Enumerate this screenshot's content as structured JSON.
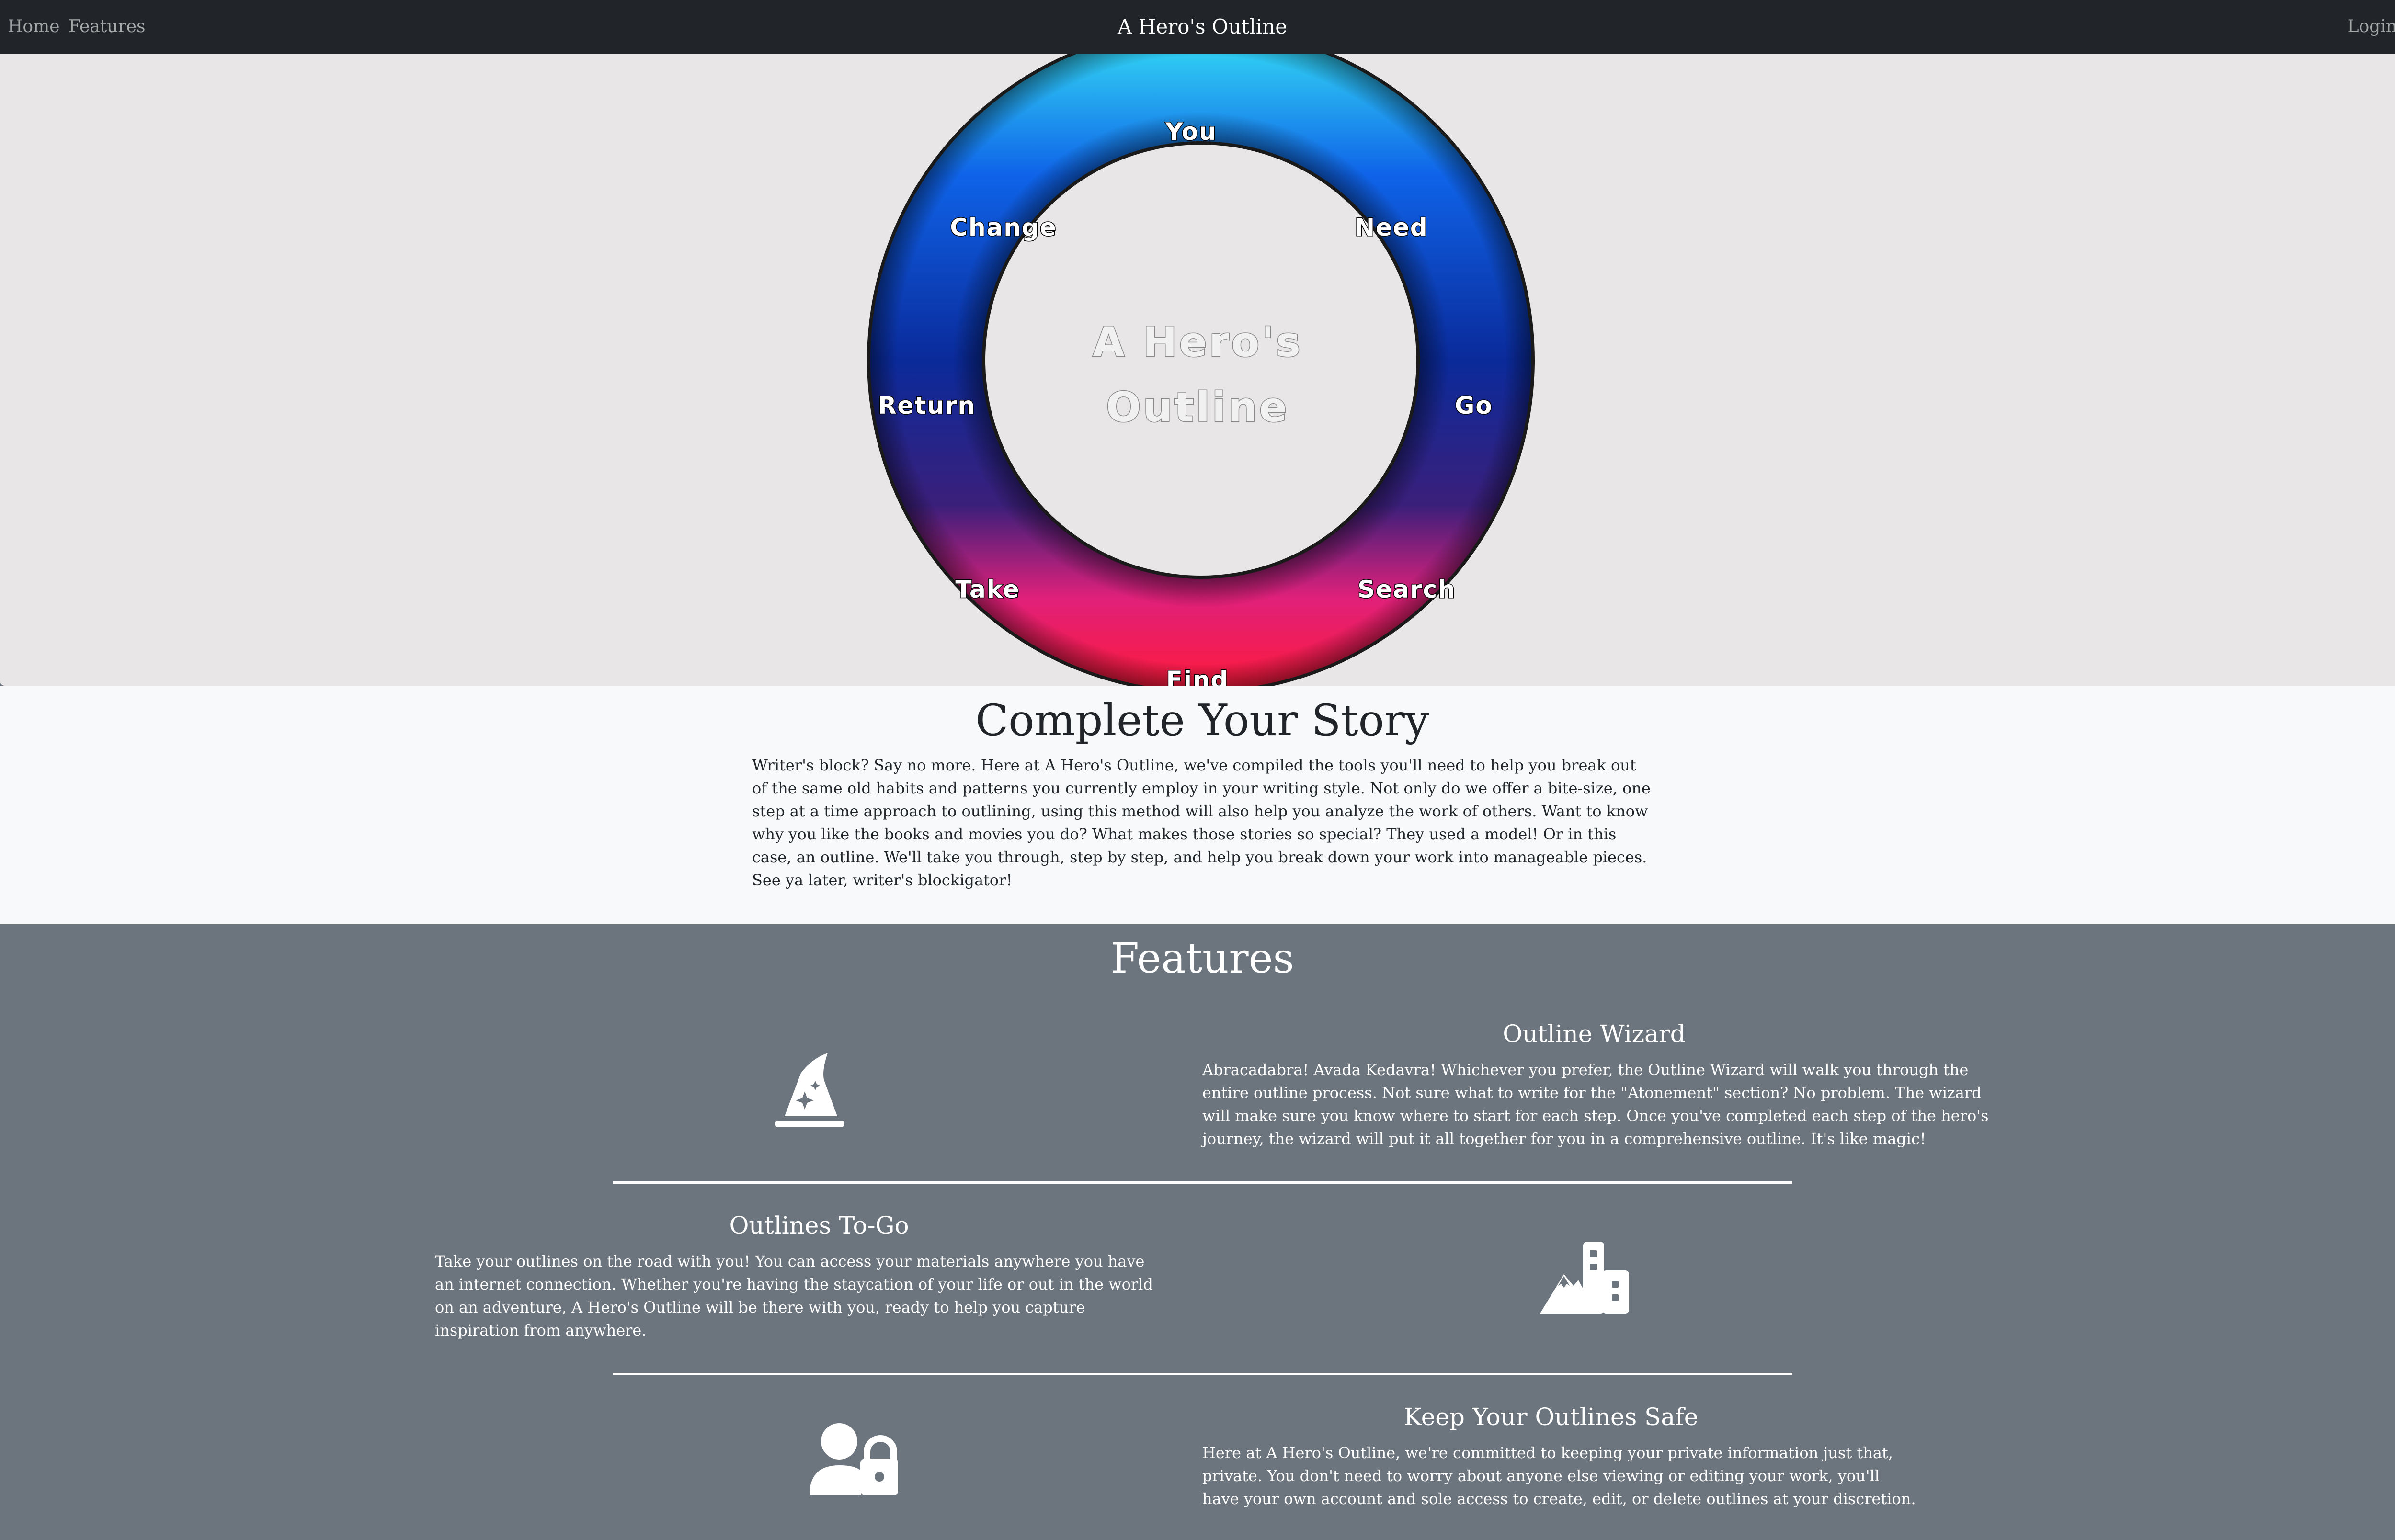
{
  "nav": {
    "home": "Home",
    "features": "Features",
    "brand": "A Hero's Outline",
    "login": "Login"
  },
  "wheel": {
    "center_title": [
      "A Hero's",
      "Outline"
    ],
    "steps": [
      "You",
      "Need",
      "Go",
      "Search",
      "Find",
      "Take",
      "Return",
      "Change"
    ]
  },
  "story": {
    "title": "Complete Your Story",
    "text": "Writer's block? Say no more. Here at A Hero's Outline, we've compiled the tools you'll need to help you break out of the same old habits and patterns you currently employ in your writing style. Not only do we offer a bite-size, one step at a time approach to outlining, using this method will also help you analyze the work of others. Want to know why you like the books and movies you do? What makes those stories so special? They used a model! Or in this case, an outline. We'll take you through, step by step, and help you break down your work into manageable pieces. See ya later, writer's blockigator!"
  },
  "features": {
    "title": "Features",
    "items": [
      {
        "title": "Outline Wizard",
        "text": "Abracadabra! Avada Kedavra! Whichever you prefer, the Outline Wizard will walk you through the entire outline process. Not sure what to write for the \"Atonement\" section? No problem. The wizard will make sure you know where to start for each step. Once you've completed each step of the hero's journey, the wizard will put it all together for you in a comprehensive outline. It's like magic!",
        "icon": "wizard-hat-icon"
      },
      {
        "title": "Outlines To-Go",
        "text": "Take your outlines on the road with you! You can access your materials anywhere you have an internet connection. Whether you're having the staycation of your life or out in the world on an adventure, A Hero's Outline will be there with you, ready to help you capture inspiration from anywhere.",
        "icon": "mountain-city-icon"
      },
      {
        "title": "Keep Your Outlines Safe",
        "text": "Here at A Hero's Outline, we're committed to keeping your private information just that, private. You don't need to worry about anyone else viewing or editing your work, you'll have your own account and sole access to create, edit, or delete outlines at your discretion.",
        "icon": "user-lock-icon"
      }
    ]
  },
  "colors": {
    "navbar": "#212529",
    "hero_bg": "#e9e6e8",
    "story_bg": "#f8f9fa",
    "features_bg": "#6c757d",
    "ring_top": "#35e0f5",
    "ring_mid": "#0a2a9a",
    "ring_bottom": "#ff1a4a"
  }
}
